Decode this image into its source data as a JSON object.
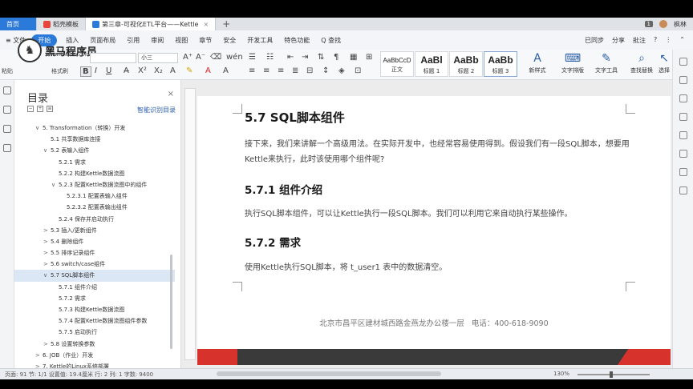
{
  "tabs": [
    {
      "label": "首页",
      "kind": "home"
    },
    {
      "label": "稻壳模板",
      "icon": "docer-icon",
      "kind": "normal"
    },
    {
      "label": "第三章-可视化ETL平台——Kettle",
      "icon": "word-doc-icon",
      "kind": "active"
    }
  ],
  "tab_plus": "+",
  "tab_right": {
    "badge": "1",
    "user": "枫林"
  },
  "menu": {
    "file": "≡ 文件",
    "start": "开始",
    "items": [
      "插入",
      "页面布局",
      "引用",
      "审阅",
      "视图",
      "章节",
      "安全",
      "开发工具",
      "特色功能",
      "Q 查找"
    ],
    "right": [
      "已同步",
      "分享",
      "批注",
      "?",
      "⋮",
      "⌃"
    ]
  },
  "logo": {
    "name": "黑马程序员",
    "url": "www.itheima.com"
  },
  "toolbar": {
    "paste": "粘贴",
    "format_painter": "格式刷",
    "font_size": "小三",
    "styles": [
      {
        "sample": "AaBbCcD",
        "label": "正文"
      },
      {
        "sample": "AaBl",
        "label": "标题 1"
      },
      {
        "sample": "AaBb",
        "label": "标题 2"
      },
      {
        "sample": "AaBb",
        "label": "标题 3"
      }
    ],
    "new_style": "新样式",
    "tools": [
      {
        "glyph": "⌨",
        "label": "文字排版"
      },
      {
        "glyph": "✎",
        "label": "文字工具"
      },
      {
        "glyph": "⌕",
        "label": "查找替换"
      },
      {
        "glyph": "↖",
        "label": "选择"
      }
    ]
  },
  "toc": {
    "title": "目录",
    "smart": "智能识别目录",
    "items": [
      {
        "text": "5. Transformation（转换）开发",
        "arrow": "∨",
        "level": 1
      },
      {
        "text": "5.1 共享数据库连接",
        "arrow": "",
        "level": 2
      },
      {
        "text": "5.2 表输入组件",
        "arrow": "∨",
        "level": 2
      },
      {
        "text": "5.2.1 需求",
        "arrow": "",
        "level": 3
      },
      {
        "text": "5.2.2 构建Kettle数据流图",
        "arrow": "",
        "level": 3
      },
      {
        "text": "5.2.3 配置Kettle数据流图中的组件",
        "arrow": "∨",
        "level": 3
      },
      {
        "text": "5.2.3.1 配置表输入组件",
        "arrow": "",
        "level": 4
      },
      {
        "text": "5.2.3.2 配置表输出组件",
        "arrow": "",
        "level": 4
      },
      {
        "text": "5.2.4 保存并启动执行",
        "arrow": "",
        "level": 3
      },
      {
        "text": "5.3 插入/更新组件",
        "arrow": ">",
        "level": 2
      },
      {
        "text": "5.4 删除组件",
        "arrow": ">",
        "level": 2
      },
      {
        "text": "5.5 排序记录组件",
        "arrow": ">",
        "level": 2
      },
      {
        "text": "5.6 switch/case组件",
        "arrow": ">",
        "level": 2
      },
      {
        "text": "5.7 SQL脚本组件",
        "arrow": "∨",
        "level": 2,
        "selected": true
      },
      {
        "text": "5.7.1 组件介绍",
        "arrow": "",
        "level": 3
      },
      {
        "text": "5.7.2 需求",
        "arrow": "",
        "level": 3
      },
      {
        "text": "5.7.3 构建Kettle数据流图",
        "arrow": "",
        "level": 3
      },
      {
        "text": "5.7.4 配置Kettle数据流图组件参数",
        "arrow": "",
        "level": 3
      },
      {
        "text": "5.7.5 启动执行",
        "arrow": "",
        "level": 3
      },
      {
        "text": "5.8 设置转换参数",
        "arrow": ">",
        "level": 2
      },
      {
        "text": "6. JOB（作业）开发",
        "arrow": ">",
        "level": 1
      },
      {
        "text": "7. Kettle的Linux系统部署",
        "arrow": ">",
        "level": 1
      }
    ]
  },
  "doc": {
    "h_57": "5.7 SQL脚本组件",
    "p_57": "接下来，我们来讲解一个高级用法。在实际开发中，也经常容易使用得到。假设我们有一段SQL脚本，想要用Kettle来执行，此时该使用哪个组件呢?",
    "h_571": "5.7.1 组件介绍",
    "p_571": "执行SQL脚本组件，可以让Kettle执行一段SQL脚本。我们可以利用它来自动执行某些操作。",
    "h_572": "5.7.2 需求",
    "p_572": "使用Kettle执行SQL脚本，将 t_user1 表中的数据清空。",
    "footer": "北京市昌平区建材城西路金燕龙办公楼一层 电话：400-618-9090"
  },
  "status": {
    "left": "页面: 91  节: 1/1  设置值: 19.4厘米  行: 2  列: 1  字数: 9400",
    "zoom": "130%"
  }
}
